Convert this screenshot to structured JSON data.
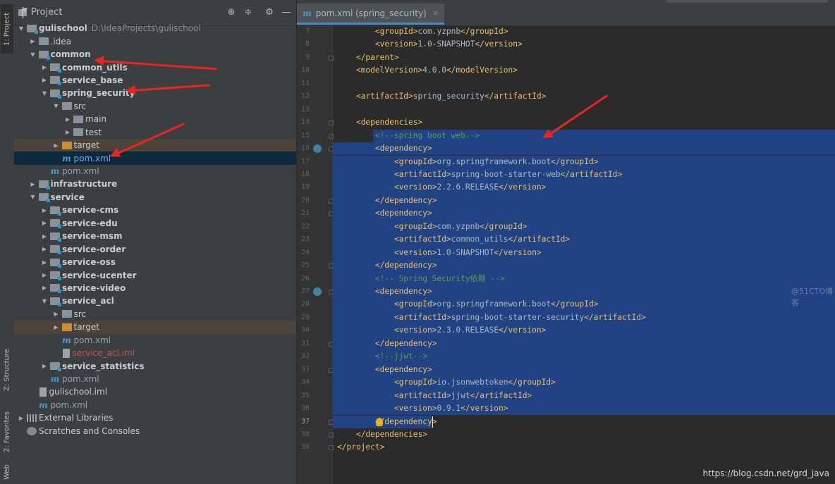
{
  "left_stripe": {
    "tabs": [
      "1: Project",
      "Z: Structure",
      "2: Favorites",
      "Web"
    ]
  },
  "project_panel": {
    "title": "Project",
    "toolbar_icons": [
      "locate-icon",
      "collapse-icon",
      "gear-icon",
      "minimize-icon"
    ],
    "tree": [
      {
        "depth": 0,
        "arrow": "down",
        "icon": "module",
        "label": "gulischool",
        "path": "D:\\IdeaProjects\\gulischool",
        "style": "bold"
      },
      {
        "depth": 1,
        "arrow": "right",
        "icon": "folder",
        "label": ".idea",
        "style": "normal"
      },
      {
        "depth": 1,
        "arrow": "down",
        "icon": "module",
        "label": "common",
        "style": "bold"
      },
      {
        "depth": 2,
        "arrow": "right",
        "icon": "module",
        "label": "common_utils",
        "style": "bold"
      },
      {
        "depth": 2,
        "arrow": "right",
        "icon": "module",
        "label": "service_base",
        "style": "bold"
      },
      {
        "depth": 2,
        "arrow": "down",
        "icon": "module",
        "label": "spring_security",
        "style": "bold"
      },
      {
        "depth": 3,
        "arrow": "down",
        "icon": "folder",
        "label": "src",
        "style": "normal"
      },
      {
        "depth": 4,
        "arrow": "right",
        "icon": "folder",
        "label": "main",
        "style": "normal"
      },
      {
        "depth": 4,
        "arrow": "right",
        "icon": "folder",
        "label": "test",
        "style": "normal"
      },
      {
        "depth": 3,
        "arrow": "right",
        "icon": "folder-orange",
        "label": "target",
        "style": "normal",
        "bg": "hl"
      },
      {
        "depth": 3,
        "arrow": "",
        "icon": "maven",
        "label": "pom.xml",
        "style": "pomsel",
        "bg": "sel"
      },
      {
        "depth": 2,
        "arrow": "",
        "icon": "maven",
        "label": "pom.xml",
        "style": "pom"
      },
      {
        "depth": 1,
        "arrow": "right",
        "icon": "module",
        "label": "infrastructure",
        "style": "bold"
      },
      {
        "depth": 1,
        "arrow": "down",
        "icon": "module",
        "label": "service",
        "style": "bold"
      },
      {
        "depth": 2,
        "arrow": "right",
        "icon": "module",
        "label": "service-cms",
        "style": "bold"
      },
      {
        "depth": 2,
        "arrow": "right",
        "icon": "module",
        "label": "service-edu",
        "style": "bold"
      },
      {
        "depth": 2,
        "arrow": "right",
        "icon": "module",
        "label": "service-msm",
        "style": "bold"
      },
      {
        "depth": 2,
        "arrow": "right",
        "icon": "module",
        "label": "service-order",
        "style": "bold"
      },
      {
        "depth": 2,
        "arrow": "right",
        "icon": "module",
        "label": "service-oss",
        "style": "bold"
      },
      {
        "depth": 2,
        "arrow": "right",
        "icon": "module",
        "label": "service-ucenter",
        "style": "bold"
      },
      {
        "depth": 2,
        "arrow": "right",
        "icon": "module",
        "label": "service-video",
        "style": "bold"
      },
      {
        "depth": 2,
        "arrow": "down",
        "icon": "module",
        "label": "service_acl",
        "style": "bold"
      },
      {
        "depth": 3,
        "arrow": "right",
        "icon": "folder",
        "label": "src",
        "style": "normal"
      },
      {
        "depth": 3,
        "arrow": "right",
        "icon": "folder-orange",
        "label": "target",
        "style": "normal",
        "bg": "hl"
      },
      {
        "depth": 3,
        "arrow": "",
        "icon": "maven",
        "label": "pom.xml",
        "style": "pom"
      },
      {
        "depth": 3,
        "arrow": "",
        "icon": "file",
        "label": "service_acl.iml",
        "style": "red"
      },
      {
        "depth": 2,
        "arrow": "right",
        "icon": "module",
        "label": "service_statistics",
        "style": "bold"
      },
      {
        "depth": 2,
        "arrow": "",
        "icon": "maven",
        "label": "pom.xml",
        "style": "pom"
      },
      {
        "depth": 1,
        "arrow": "",
        "icon": "file",
        "label": "gulischool.iml",
        "style": "normal"
      },
      {
        "depth": 1,
        "arrow": "",
        "icon": "maven",
        "label": "pom.xml",
        "style": "pom"
      },
      {
        "depth": 0,
        "arrow": "right",
        "icon": "library",
        "label": "External Libraries",
        "style": "normal"
      },
      {
        "depth": 0,
        "arrow": "",
        "icon": "scratch",
        "label": "Scratches and Consoles",
        "style": "normal"
      }
    ]
  },
  "editor": {
    "tab_label": "pom.xml (spring_security)",
    "current_line": 37,
    "lines": [
      {
        "n": 7,
        "text": "        <groupId>com.yzpnb</groupId>"
      },
      {
        "n": 8,
        "text": "        <version>1.0-SNAPSHOT</version>"
      },
      {
        "n": 9,
        "text": "    </parent>"
      },
      {
        "n": 10,
        "text": "    <modelVersion>4.0.0</modelVersion>"
      },
      {
        "n": 11,
        "text": ""
      },
      {
        "n": 12,
        "text": "    <artifactId>spring_security</artifactId>"
      },
      {
        "n": 13,
        "text": ""
      },
      {
        "n": 14,
        "text": "    <dependencies>"
      },
      {
        "n": 15,
        "text": "        <!--spring boot web-->"
      },
      {
        "n": 16,
        "text": "        <dependency>"
      },
      {
        "n": 17,
        "text": "            <groupId>org.springframework.boot</groupId>"
      },
      {
        "n": 18,
        "text": "            <artifactId>spring-boot-starter-web</artifactId>"
      },
      {
        "n": 19,
        "text": "            <version>2.2.6.RELEASE</version>"
      },
      {
        "n": 20,
        "text": "        </dependency>"
      },
      {
        "n": 21,
        "text": "        <dependency>"
      },
      {
        "n": 22,
        "text": "            <groupId>com.yzpnb</groupId>"
      },
      {
        "n": 23,
        "text": "            <artifactId>common_utils</artifactId>"
      },
      {
        "n": 24,
        "text": "            <version>1.0-SNAPSHOT</version>"
      },
      {
        "n": 25,
        "text": "        </dependency>"
      },
      {
        "n": 26,
        "text": "        <!-- Spring Security依赖 -->"
      },
      {
        "n": 27,
        "text": "        <dependency>"
      },
      {
        "n": 28,
        "text": "            <groupId>org.springframework.boot</groupId>"
      },
      {
        "n": 29,
        "text": "            <artifactId>spring-boot-starter-security</artifactId>"
      },
      {
        "n": 30,
        "text": "            <version>2.3.0.RELEASE</version>"
      },
      {
        "n": 31,
        "text": "        </dependency>"
      },
      {
        "n": 32,
        "text": "        <!--jjwt-->"
      },
      {
        "n": 33,
        "text": "        <dependency>"
      },
      {
        "n": 34,
        "text": "            <groupId>io.jsonwebtoken</groupId>"
      },
      {
        "n": 35,
        "text": "            <artifactId>jjwt</artifactId>"
      },
      {
        "n": 36,
        "text": "            <version>0.9.1</version>"
      },
      {
        "n": 37,
        "text": "        </dependency>"
      },
      {
        "n": 38,
        "text": "    </dependencies>"
      },
      {
        "n": 39,
        "text": "</project>"
      }
    ],
    "selection_lines": [
      15,
      37
    ],
    "comment_lines": [
      15,
      26,
      32
    ]
  },
  "colors": {
    "tag": "#e8bf6a",
    "text": "#a9b7c6",
    "comment": "#629755",
    "selection": "#214283",
    "annotation_arrow": "#e8261f"
  },
  "watermark": "https://blog.csdn.net/grd_java",
  "faint_watermark": "@51CTO博客"
}
